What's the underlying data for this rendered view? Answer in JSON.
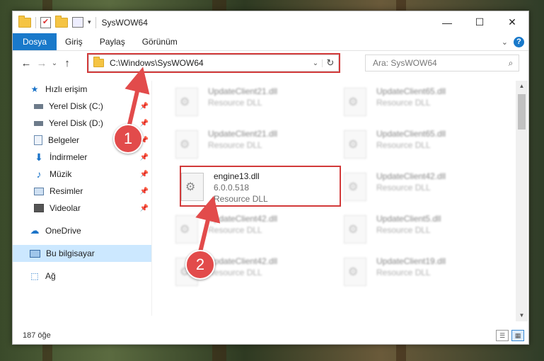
{
  "window": {
    "title": "SysWOW64"
  },
  "window_controls": {
    "minimize": "—",
    "maximize": "☐",
    "close": "✕"
  },
  "ribbon": {
    "tabs": [
      {
        "label": "Dosya"
      },
      {
        "label": "Giriş"
      },
      {
        "label": "Paylaş"
      },
      {
        "label": "Görünüm"
      }
    ],
    "help": "?"
  },
  "nav": {
    "back": "←",
    "forward": "→",
    "recent": "⌄",
    "up": "↑",
    "address": "C:\\Windows\\SysWOW64",
    "refresh": "↻",
    "search_placeholder": "Ara: SysWOW64"
  },
  "sidebar": {
    "quick_access": {
      "label": "Hızlı erişim",
      "icon": "star-icon"
    },
    "items": [
      {
        "label": "Yerel Disk (C:)",
        "icon": "drive-icon"
      },
      {
        "label": "Yerel Disk (D:)",
        "icon": "drive-icon"
      },
      {
        "label": "Belgeler",
        "icon": "documents-icon"
      },
      {
        "label": "İndirmeler",
        "icon": "download-icon"
      },
      {
        "label": "Müzik",
        "icon": "music-icon"
      },
      {
        "label": "Resimler",
        "icon": "pictures-icon"
      },
      {
        "label": "Videolar",
        "icon": "video-icon"
      }
    ],
    "onedrive": {
      "label": "OneDrive",
      "icon": "cloud-icon"
    },
    "this_pc": {
      "label": "Bu bilgisayar",
      "icon": "computer-icon"
    },
    "network": {
      "label": "Ağ",
      "icon": "network-icon"
    }
  },
  "files": [
    {
      "name": "UpdateClient21.dll",
      "type": "Resource DLL"
    },
    {
      "name": "UpdateClient65.dll",
      "type": "Resource DLL"
    },
    {
      "name": "UpdateClient21.dll",
      "type": "Resource DLL"
    },
    {
      "name": "UpdateClient65.dll",
      "type": "Resource DLL"
    },
    {
      "name": "engine13.dll",
      "version": "6.0.0.518",
      "type": "Resource DLL"
    },
    {
      "name": "UpdateClient42.dll",
      "type": "Resource DLL"
    },
    {
      "name": "UpdateClient42.dll",
      "type": "Resource DLL"
    },
    {
      "name": "UpdateClient5.dll",
      "type": "Resource DLL"
    },
    {
      "name": "UpdateClient42.dll",
      "type": "Resource DLL"
    },
    {
      "name": "UpdateClient19.dll",
      "type": "Resource DLL"
    }
  ],
  "status": {
    "item_count": "187 öğe"
  },
  "annotations": {
    "step1": "1",
    "step2": "2"
  }
}
